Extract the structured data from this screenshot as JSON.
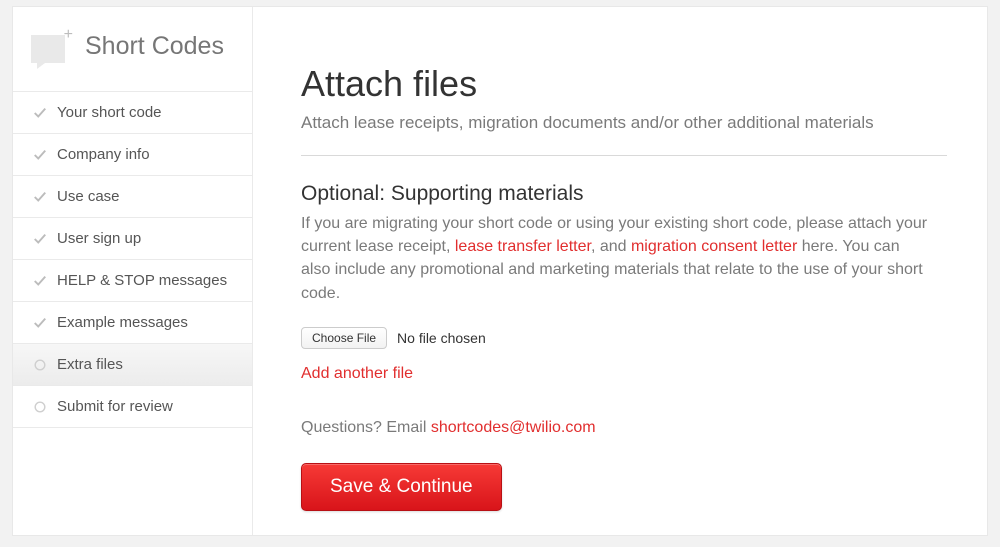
{
  "sidebar": {
    "title": "Short Codes",
    "items": [
      {
        "label": "Your short code",
        "status": "done"
      },
      {
        "label": "Company info",
        "status": "done"
      },
      {
        "label": "Use case",
        "status": "done"
      },
      {
        "label": "User sign up",
        "status": "done"
      },
      {
        "label": "HELP & STOP messages",
        "status": "done"
      },
      {
        "label": "Example messages",
        "status": "done"
      },
      {
        "label": "Extra files",
        "status": "current"
      },
      {
        "label": "Submit for review",
        "status": "pending"
      }
    ]
  },
  "main": {
    "title": "Attach files",
    "subtitle": "Attach lease receipts, migration documents and/or other additional materials",
    "section_title": "Optional: Supporting materials",
    "desc_part1": "If you are migrating your short code or using your existing short code, please attach your current lease receipt, ",
    "link1": "lease transfer letter",
    "desc_part2": ", and ",
    "link2": "migration consent letter",
    "desc_part3": " here. You can also include any promotional and marketing materials that relate to the use of your short code.",
    "choose_file_label": "Choose File",
    "file_status": "No file chosen",
    "add_another_label": "Add another file",
    "questions_prefix": "Questions? Email ",
    "questions_email": "shortcodes@twilio.com",
    "save_label": "Save & Continue"
  }
}
